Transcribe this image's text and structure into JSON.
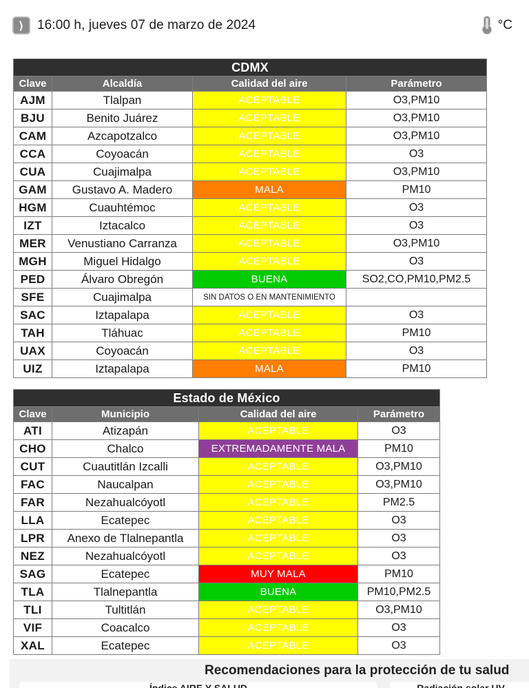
{
  "statusbar": {
    "clock_icon": "clock-icon",
    "datetime": "16:00 h, jueves 07 de marzo de 2024",
    "thermometer_icon": "thermometer-icon",
    "unit": "°C"
  },
  "colors": {
    "buena": "#00cc00",
    "aceptable": "#ffff00",
    "mala": "#ff7e00",
    "muy_mala": "#ff0000",
    "extremadamente_mala": "#8f3f97",
    "sin_datos": "#ffffff",
    "title_bar": "#2f2f2f",
    "header_bar": "#6e6e6e",
    "grid_line": "#7d7d7d",
    "panel_bg": "#f2f2f2"
  },
  "cdmx": {
    "title": "CDMX",
    "columns": [
      "Clave",
      "Alcaldía",
      "Calidad del aire",
      "Parámetro"
    ],
    "rows": [
      {
        "clave": "AJM",
        "zona": "Tlalpan",
        "calidad": "ACEPTABLE",
        "clase": "aceptable",
        "parametro": "O3,PM10"
      },
      {
        "clave": "BJU",
        "zona": "Benito Juárez",
        "calidad": "ACEPTABLE",
        "clase": "aceptable",
        "parametro": "O3,PM10"
      },
      {
        "clave": "CAM",
        "zona": "Azcapotzalco",
        "calidad": "ACEPTABLE",
        "clase": "aceptable",
        "parametro": "O3,PM10"
      },
      {
        "clave": "CCA",
        "zona": "Coyoacán",
        "calidad": "ACEPTABLE",
        "clase": "aceptable",
        "parametro": "O3"
      },
      {
        "clave": "CUA",
        "zona": "Cuajimalpa",
        "calidad": "ACEPTABLE",
        "clase": "aceptable",
        "parametro": "O3,PM10"
      },
      {
        "clave": "GAM",
        "zona": "Gustavo A. Madero",
        "calidad": "MALA",
        "clase": "mala",
        "parametro": "PM10"
      },
      {
        "clave": "HGM",
        "zona": "Cuauhtémoc",
        "calidad": "ACEPTABLE",
        "clase": "aceptable",
        "parametro": "O3"
      },
      {
        "clave": "IZT",
        "zona": "Iztacalco",
        "calidad": "ACEPTABLE",
        "clase": "aceptable",
        "parametro": "O3"
      },
      {
        "clave": "MER",
        "zona": "Venustiano Carranza",
        "calidad": "ACEPTABLE",
        "clase": "aceptable",
        "parametro": "O3,PM10"
      },
      {
        "clave": "MGH",
        "zona": "Miguel Hidalgo",
        "calidad": "ACEPTABLE",
        "clase": "aceptable",
        "parametro": "O3"
      },
      {
        "clave": "PED",
        "zona": "Álvaro Obregón",
        "calidad": "BUENA",
        "clase": "buena",
        "parametro": "SO2,CO,PM10,PM2.5"
      },
      {
        "clave": "SFE",
        "zona": "Cuajimalpa",
        "calidad": "SIN DATOS O EN MANTENIMIENTO",
        "clase": "sindatos",
        "parametro": ""
      },
      {
        "clave": "SAC",
        "zona": "Iztapalapa",
        "calidad": "ACEPTABLE",
        "clase": "aceptable",
        "parametro": "O3"
      },
      {
        "clave": "TAH",
        "zona": "Tláhuac",
        "calidad": "ACEPTABLE",
        "clase": "aceptable",
        "parametro": "PM10"
      },
      {
        "clave": "UAX",
        "zona": "Coyoacán",
        "calidad": "ACEPTABLE",
        "clase": "aceptable",
        "parametro": "O3"
      },
      {
        "clave": "UIZ",
        "zona": "Iztapalapa",
        "calidad": "MALA",
        "clase": "mala",
        "parametro": "PM10"
      }
    ]
  },
  "edomex": {
    "title": "Estado de México",
    "columns": [
      "Clave",
      "Municipio",
      "Calidad del aire",
      "Parámetro"
    ],
    "rows": [
      {
        "clave": "ATI",
        "zona": "Atizapán",
        "calidad": "ACEPTABLE",
        "clase": "aceptable",
        "parametro": "O3"
      },
      {
        "clave": "CHO",
        "zona": "Chalco",
        "calidad": "EXTREMADAMENTE MALA",
        "clase": "extrema",
        "parametro": "PM10"
      },
      {
        "clave": "CUT",
        "zona": "Cuautitlán Izcalli",
        "calidad": "ACEPTABLE",
        "clase": "aceptable",
        "parametro": "O3,PM10"
      },
      {
        "clave": "FAC",
        "zona": "Naucalpan",
        "calidad": "ACEPTABLE",
        "clase": "aceptable",
        "parametro": "O3,PM10"
      },
      {
        "clave": "FAR",
        "zona": "Nezahualcóyotl",
        "calidad": "ACEPTABLE",
        "clase": "aceptable",
        "parametro": "PM2.5"
      },
      {
        "clave": "LLA",
        "zona": "Ecatepec",
        "calidad": "ACEPTABLE",
        "clase": "aceptable",
        "parametro": "O3"
      },
      {
        "clave": "LPR",
        "zona": "Anexo de Tlalnepantla",
        "calidad": "ACEPTABLE",
        "clase": "aceptable",
        "parametro": "O3"
      },
      {
        "clave": "NEZ",
        "zona": "Nezahualcóyotl",
        "calidad": "ACEPTABLE",
        "clase": "aceptable",
        "parametro": "O3"
      },
      {
        "clave": "SAG",
        "zona": "Ecatepec",
        "calidad": "MUY MALA",
        "clase": "muymala",
        "parametro": "PM10"
      },
      {
        "clave": "TLA",
        "zona": "Tlalnepantla",
        "calidad": "BUENA",
        "clase": "buena",
        "parametro": "PM10,PM2.5"
      },
      {
        "clave": "TLI",
        "zona": "Tultitlán",
        "calidad": "ACEPTABLE",
        "clase": "aceptable",
        "parametro": "O3,PM10"
      },
      {
        "clave": "VIF",
        "zona": "Coacalco",
        "calidad": "ACEPTABLE",
        "clase": "aceptable",
        "parametro": "O3"
      },
      {
        "clave": "XAL",
        "zona": "Ecatepec",
        "calidad": "ACEPTABLE",
        "clase": "aceptable",
        "parametro": "O3"
      }
    ]
  },
  "recomendaciones": {
    "title": "Recomendaciones para la protección de tu salud",
    "card_left_title": "Índice AIRE Y SALUD",
    "card_right_title": "Radiación solar UV"
  }
}
